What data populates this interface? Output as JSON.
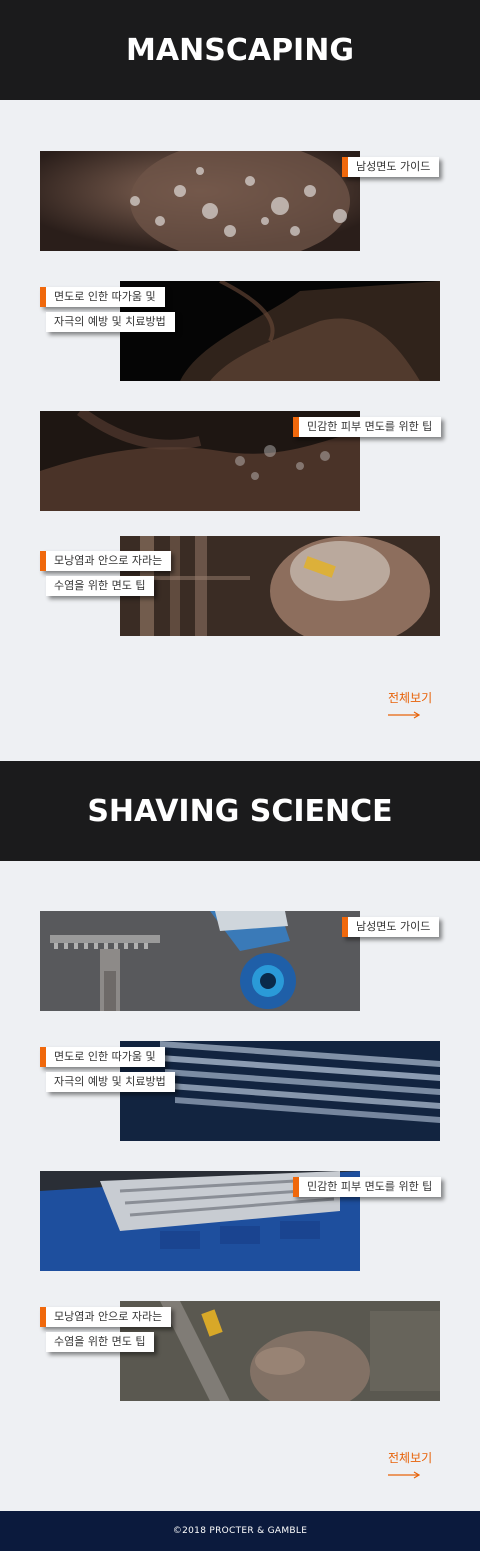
{
  "sections": [
    {
      "title": "MANSCAPING",
      "cards": [
        {
          "lines": [
            "남성면도 가이드"
          ]
        },
        {
          "lines": [
            "면도로 인한 따가움 및",
            "자극의 예방 및 치료방법"
          ]
        },
        {
          "lines": [
            "민감한 피부 면도를 위한 팁"
          ]
        },
        {
          "lines": [
            "모낭염과 안으로 자라는",
            "수염을 위한 면도 팁"
          ]
        }
      ],
      "view_all": "전체보기"
    },
    {
      "title": "SHAVING SCIENCE",
      "cards": [
        {
          "lines": [
            "남성면도 가이드"
          ]
        },
        {
          "lines": [
            "면도로 인한 따가움 및",
            "자극의 예방 및 치료방법"
          ]
        },
        {
          "lines": [
            "민감한 피부 면도를 위한 팁"
          ]
        },
        {
          "lines": [
            "모낭염과 안으로 자라는",
            "수염을 위한 면도 팁"
          ]
        }
      ],
      "view_all": "전체보기"
    }
  ],
  "footer": {
    "copyright": "©2018 PROCTER & GAMBLE"
  },
  "colors": {
    "accent": "#f0680c",
    "header_bg": "#1b1b1c",
    "footer_bg": "#0b1a3d",
    "page_bg": "#eef0f3"
  }
}
